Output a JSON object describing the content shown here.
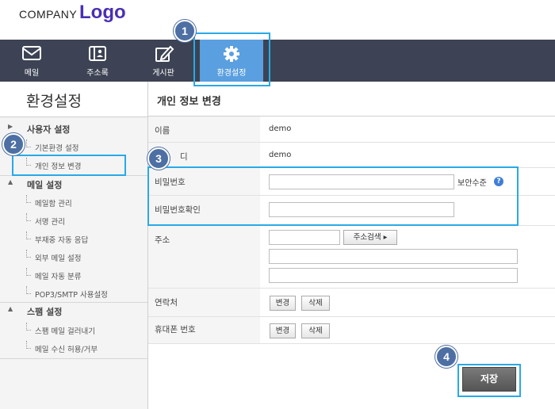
{
  "header": {
    "company": "COMPANY",
    "logo": "Logo"
  },
  "nav": {
    "items": [
      {
        "label": "메일",
        "icon": "mail-icon"
      },
      {
        "label": "주소록",
        "icon": "address-book-icon"
      },
      {
        "label": "게시판",
        "icon": "edit-icon"
      },
      {
        "label": "환경설정",
        "icon": "gear-icon"
      }
    ],
    "active_color": "#5a9fe0",
    "bg_color": "#3d4354"
  },
  "sidebar": {
    "title": "환경설정",
    "sections": [
      {
        "label": "사용자 설정",
        "items": [
          "기본환경 설정",
          "개인 정보 변경"
        ]
      },
      {
        "label": "메일 설정",
        "items": [
          "메일함 관리",
          "서명 관리",
          "부재중 자동 응답",
          "외부 메일 설정",
          "메일 자동 분류",
          "POP3/SMTP 사용설정"
        ]
      },
      {
        "label": "스팸 설정",
        "items": [
          "스팸 메일 걸러내기",
          "메일 수신 허용/거부"
        ]
      }
    ]
  },
  "content": {
    "title": "개인 정보 변경",
    "name_label": "이름",
    "name_value": "demo",
    "id_label": "디",
    "id_value": "demo",
    "password_label": "비밀번호",
    "security_level_label": "보안수준",
    "password_confirm_label": "비밀번호확인",
    "address_label": "주소",
    "address_search_label": "주소검색 ▸",
    "contact_label": "연락처",
    "mobile_label": "휴대폰 번호",
    "change_label": "변경",
    "delete_label": "삭제",
    "save_label": "저장"
  },
  "callouts": [
    "1",
    "2",
    "3",
    "4"
  ],
  "highlight_color": "#29a9e8"
}
